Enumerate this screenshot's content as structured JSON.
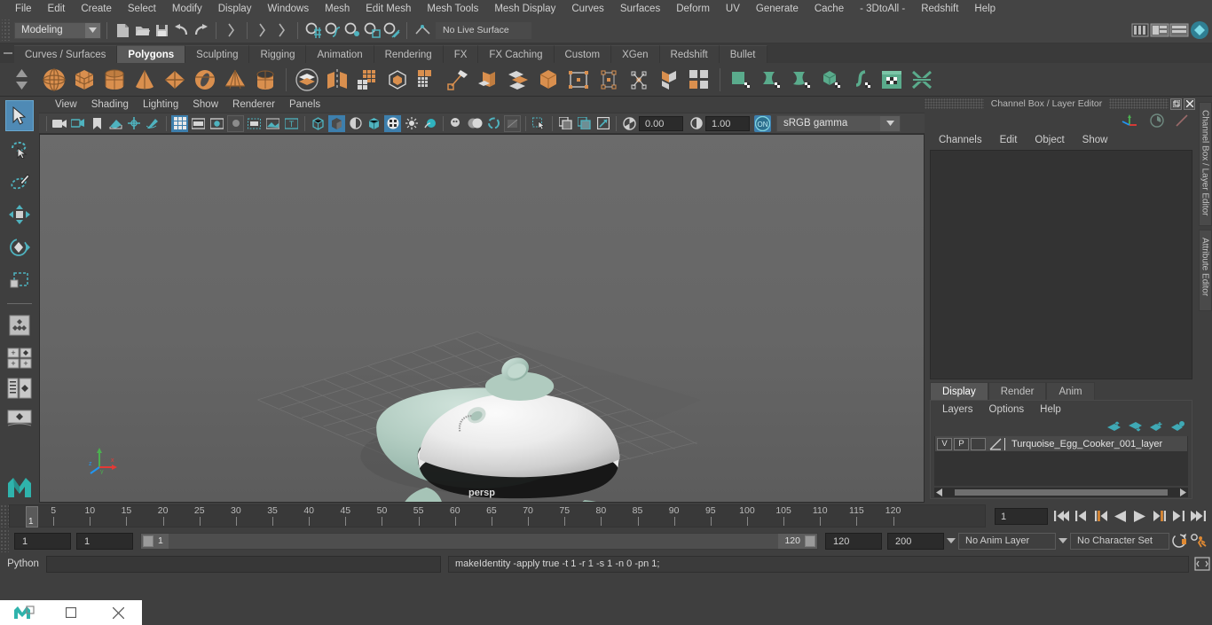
{
  "menubar": {
    "items": [
      "File",
      "Edit",
      "Create",
      "Select",
      "Modify",
      "Display",
      "Windows",
      "Mesh",
      "Edit Mesh",
      "Mesh Tools",
      "Mesh Display",
      "Curves",
      "Surfaces",
      "Deform",
      "UV",
      "Generate",
      "Cache",
      "- 3DtoAll -",
      "Redshift",
      "Help"
    ]
  },
  "statusline": {
    "menu_set": "Modeling",
    "live_surface_label": "No Live Surface",
    "icons": [
      "new-scene-icon",
      "open-scene-icon",
      "save-scene-icon",
      "undo-icon",
      "redo-icon",
      "select-by-hierarchy-icon",
      "select-by-object-icon",
      "select-by-component-icon",
      "snap-to-grid-icon",
      "snap-to-curve-icon",
      "snap-to-point-icon",
      "snap-to-projected-center-icon",
      "snap-to-view-plane-icon",
      "make-live-icon",
      "show-hide-editors-icon",
      "attribute-editor-icon",
      "channel-box-icon",
      "modeling-toolkit-icon"
    ]
  },
  "shelf_tabs": {
    "items": [
      "Curves / Surfaces",
      "Polygons",
      "Sculpting",
      "Rigging",
      "Animation",
      "Rendering",
      "FX",
      "FX Caching",
      "Custom",
      "XGen",
      "Redshift",
      "Bullet"
    ],
    "active": "Polygons"
  },
  "shelf_icons": [
    "poly-sphere-icon",
    "poly-cube-icon",
    "poly-cylinder-icon",
    "poly-cone-icon",
    "poly-plane-icon",
    "poly-torus-icon",
    "poly-pyramid-icon",
    "poly-pipe-icon",
    "combine-icon",
    "separate-icon",
    "booleans-icon",
    "smooth-icon",
    "mirror-geometry-icon",
    "extrude-icon",
    "bevel-icon",
    "bridge-icon",
    "append-polygon-icon",
    "multi-cut-icon",
    "target-weld-icon",
    "connect-icon",
    "quad-draw-icon",
    "sculpt-icon",
    "wedge-icon",
    "poke-icon",
    "insert-edge-loop-icon",
    "offset-edge-loop-icon",
    "uv-editor-icon",
    "uv-planar-icon",
    "uv-cylindrical-icon",
    "uv-automatic-icon",
    "uv-unfold-icon",
    "uv-layout-icon",
    "uv-cut-icon"
  ],
  "toolbox": {
    "items": [
      "select-tool",
      "lasso-select-tool",
      "paint-select-tool",
      "move-tool",
      "rotate-tool",
      "scale-tool",
      "last-tool-used",
      "snap-align-objects",
      "toggle-outliner-persp-layout",
      "toggle-hypergraph-layout",
      "persp-view-layout",
      "maya-logo"
    ],
    "active": "select-tool"
  },
  "viewport": {
    "panel_menu": [
      "View",
      "Shading",
      "Lighting",
      "Show",
      "Renderer",
      "Panels"
    ],
    "camera_label": "persp",
    "exposure_value": "0.00",
    "gamma_value": "1.00",
    "color_management_toggle": "ON",
    "color_profile": "sRGB gamma",
    "toolbar_icons": [
      "select-camera-icon",
      "camera-attributes-icon",
      "bookmark-icon",
      "image-plane-icon",
      "two-d-pan-zoom-icon",
      "grease-pencil-icon",
      "grid-icon",
      "film-gate-icon",
      "resolution-gate-icon",
      "gate-mask-icon",
      "film-origin-icon",
      "safe-action-icon",
      "title-safe-icon",
      "wireframe-icon",
      "smooth-shade-icon",
      "shaded-wireframe-icon",
      "flat-shade-icon",
      "textured-icon",
      "use-default-lighting-icon",
      "use-all-lights-icon",
      "shadows-icon",
      "screen-space-ao-icon",
      "motion-blur-icon",
      "multisample-icon",
      "isolate-select-icon",
      "xray-icon",
      "xray-joints-icon",
      "xray-active-components-icon",
      "viewport-refresh-icon"
    ],
    "model_name": "Turquoise Egg Cooker"
  },
  "right_panel": {
    "title": "Channel Box / Layer Editor",
    "channel_menu": [
      "Channels",
      "Edit",
      "Object",
      "Show"
    ],
    "layer_tabs": [
      "Display",
      "Render",
      "Anim"
    ],
    "layer_tabs_active": "Display",
    "layer_menu": [
      "Layers",
      "Options",
      "Help"
    ],
    "layer_tool_icons": [
      "move-layer-up-icon",
      "move-layer-down-icon",
      "new-layer-icon",
      "new-layer-from-selected-icon"
    ],
    "layers": [
      {
        "visibility": "V",
        "playback": "P",
        "shading": "",
        "name": "Turquoise_Egg_Cooker_001_layer"
      }
    ],
    "side_tabs": [
      "Channel Box / Layer Editor",
      "Attribute Editor"
    ]
  },
  "timeline": {
    "ticks": [
      5,
      10,
      15,
      20,
      25,
      30,
      35,
      40,
      45,
      50,
      55,
      60,
      65,
      70,
      75,
      80,
      85,
      90,
      95,
      100,
      105,
      110,
      115,
      120
    ],
    "current_frame": "1",
    "current_frame_field": "1",
    "playback_buttons": [
      "go-to-start-icon",
      "step-back-key-icon",
      "step-back-frame-icon",
      "play-backwards-icon",
      "play-forwards-icon",
      "step-forward-frame-icon",
      "step-forward-key-icon",
      "go-to-end-icon"
    ]
  },
  "range_slider": {
    "anim_start": "1",
    "playback_start": "1",
    "range_left_label": "1",
    "range_right_label": "120",
    "playback_end": "120",
    "anim_end": "200",
    "anim_layer": "No Anim Layer",
    "character_set": "No Character Set",
    "icons": [
      "auto-key-icon",
      "animation-preferences-icon"
    ]
  },
  "command_line": {
    "language_label": "Python",
    "input_value": "",
    "output_text": "makeIdentity -apply true -t 1 -r 1 -s 1 -n 0 -pn 1;",
    "script_editor_icon": "script-editor-icon"
  },
  "taskbar": {
    "items": [
      "maya-app-icon",
      "restore-window-icon",
      "close-window-icon"
    ]
  },
  "colors": {
    "accent_blue": "#3d7fad",
    "shelf_orange": "#d98f4e",
    "shelf_green": "#5aab8c",
    "teal": "#3fa9b5",
    "bg_dark": "#3f3f3f",
    "viewport_bg": "#666666",
    "model_lid": "#e8e8e8",
    "model_body": "#a8c5bb"
  }
}
